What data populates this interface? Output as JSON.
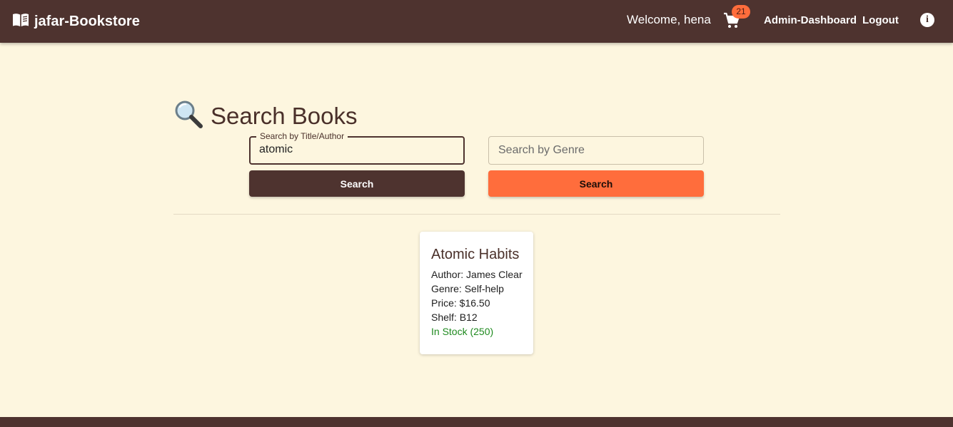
{
  "header": {
    "brand_icon": "open-book-icon",
    "brand_title": "jafar-Bookstore",
    "welcome_text": "Welcome, hena",
    "cart_icon": "cart-icon",
    "cart_count": "21",
    "admin_link": "Admin-Dashboard",
    "logout_link": "Logout",
    "info_icon": "info-icon",
    "info_glyph": "i"
  },
  "search": {
    "heading_icon": "magnifier-icon",
    "heading": "Search Books",
    "title_label": "Search by Title/Author",
    "title_value": "atomic",
    "genre_placeholder": "Search by Genre",
    "title_button": "Search",
    "genre_button": "Search"
  },
  "results": [
    {
      "title": "Atomic Habits",
      "author": "Author: James Clear",
      "genre": "Genre: Self-help",
      "price": "Price: $16.50",
      "shelf": "Shelf: B12",
      "stock": "In Stock (250)"
    }
  ],
  "colors": {
    "header_bg": "#4e332f",
    "page_bg": "#fdf6df",
    "accent": "#ff6d3c",
    "in_stock": "#1f8a1f"
  }
}
